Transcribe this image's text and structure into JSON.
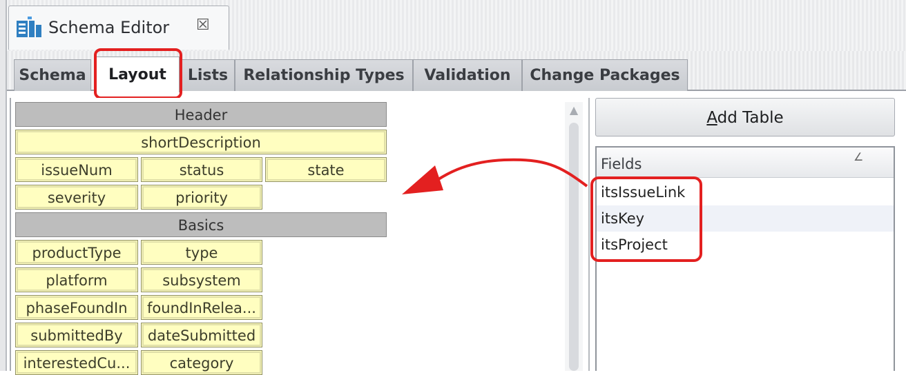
{
  "window": {
    "title": "Schema Editor",
    "icon": "schema-editor-icon",
    "close_icon": "close-icon",
    "close_glyph": "☒"
  },
  "tabs": [
    {
      "label": "Schema",
      "active": false
    },
    {
      "label": "Layout",
      "active": true
    },
    {
      "label": "Lists",
      "active": false
    },
    {
      "label": "Relationship Types",
      "active": false
    },
    {
      "label": "Validation",
      "active": false
    },
    {
      "label": "Change Packages",
      "active": false
    }
  ],
  "layout": {
    "sections": [
      {
        "header": "Header",
        "rows": [
          [
            "shortDescription"
          ],
          [
            "issueNum",
            "status",
            "state"
          ],
          [
            "severity",
            "priority"
          ]
        ]
      },
      {
        "header": "Basics",
        "rows": [
          [
            "productType",
            "type"
          ],
          [
            "platform",
            "subsystem"
          ],
          [
            "phaseFoundIn",
            "foundInRelea..."
          ],
          [
            "submittedBy",
            "dateSubmitted"
          ],
          [
            "interestedCu...",
            "category"
          ]
        ]
      }
    ]
  },
  "right_panel": {
    "add_table_label": "Add Table",
    "add_table_mnemonic": "A",
    "fields_header": "Fields",
    "fields": [
      "itsIssueLink",
      "itsKey",
      "itsProject"
    ]
  },
  "colors": {
    "highlight": "#e32020",
    "field_cell": "#fffec0",
    "section_header": "#bdbdbd"
  }
}
